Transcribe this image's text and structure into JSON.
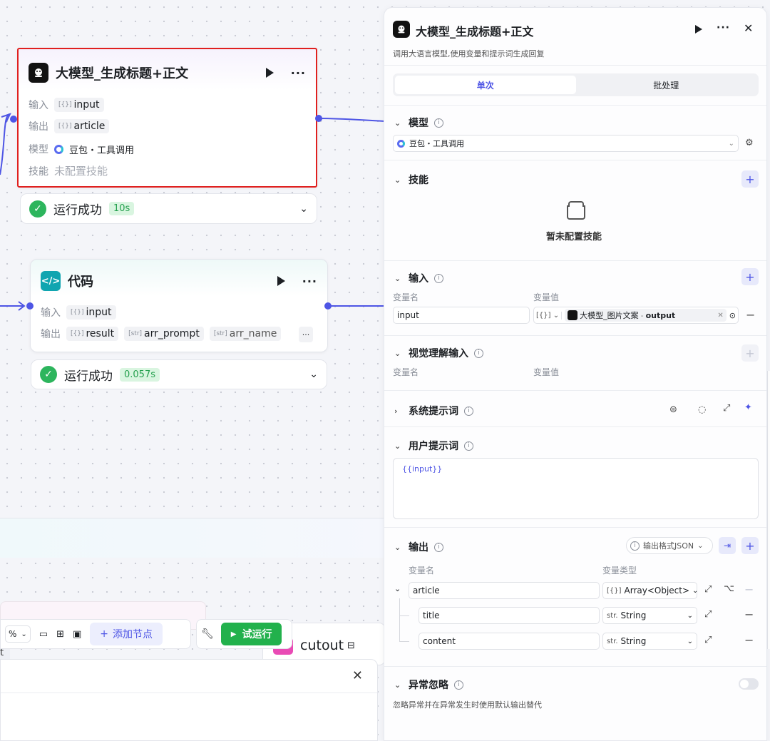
{
  "node_llm": {
    "title": "大模型_生成标题+正文",
    "rows": {
      "input_label": "输入",
      "input_value": "input",
      "output_label": "输出",
      "output_value": "article",
      "model_label": "模型",
      "model_value": "豆包・工具调用",
      "skill_label": "技能",
      "skill_value": "未配置技能"
    },
    "status": {
      "label": "运行成功",
      "time": "10s"
    }
  },
  "node_code": {
    "title": "代码",
    "rows": {
      "input_label": "输入",
      "input_value": "input",
      "output_label": "输出",
      "out1": "result",
      "out2": "arr_prompt",
      "out3": "arr_name"
    },
    "status": {
      "label": "运行成功",
      "time": "0.057s"
    }
  },
  "toolbar": {
    "zoom": "%",
    "add_node": "添加节点",
    "test_run": "试运行"
  },
  "background": {
    "cutout_label": "cutout",
    "fragment_t": "t"
  },
  "panel": {
    "title": "大模型_生成标题+正文",
    "subtitle": "调用大语言模型,使用变量和提示词生成回复",
    "tabs": [
      "单次",
      "批处理"
    ],
    "model": {
      "title": "模型",
      "value": "豆包・工具调用"
    },
    "skills": {
      "title": "技能",
      "empty": "暂未配置技能"
    },
    "inputs": {
      "title": "输入",
      "col_name": "变量名",
      "col_value": "变量值",
      "name": "input",
      "type_icon": "[{}]",
      "ref_node": "大模型_图片文案",
      "ref_sep": " - ",
      "ref_field": "output"
    },
    "vision": {
      "title": "视觉理解输入",
      "col_name": "变量名",
      "col_value": "变量值"
    },
    "system_prompt": {
      "title": "系统提示词"
    },
    "user_prompt": {
      "title": "用户提示词",
      "value": "{{input}}"
    },
    "output": {
      "title": "输出",
      "format": "输出格式JSON",
      "col_name": "变量名",
      "col_type": "变量类型",
      "fields": [
        {
          "name": "article",
          "type": "Array<Object>",
          "type_icon": "[{}]"
        },
        {
          "name": "title",
          "type": "String",
          "type_icon": "str."
        },
        {
          "name": "content",
          "type": "String",
          "type_icon": "str."
        }
      ]
    },
    "error": {
      "title": "异常忽略",
      "desc": "忽略异常并在异常发生时使用默认输出替代"
    }
  },
  "colors": {
    "accent": "#4e55e5",
    "success": "#2db55d",
    "selection": "#e0201f"
  }
}
